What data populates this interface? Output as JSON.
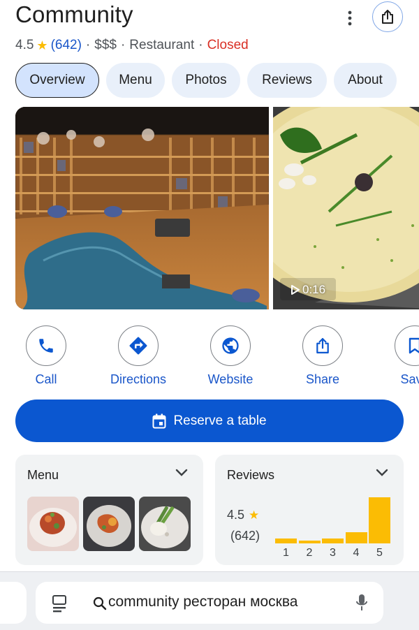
{
  "place": {
    "name": "Community",
    "rating": "4.5",
    "review_count": "(642)",
    "price": "$$$",
    "category": "Restaurant",
    "status": "Closed"
  },
  "tabs": [
    {
      "label": "Overview",
      "active": true
    },
    {
      "label": "Menu",
      "active": false
    },
    {
      "label": "Photos",
      "active": false
    },
    {
      "label": "Reviews",
      "active": false
    },
    {
      "label": "About",
      "active": false
    }
  ],
  "photos": {
    "video_duration": "0:16"
  },
  "actions": [
    {
      "label": "Call",
      "icon": "phone-icon"
    },
    {
      "label": "Directions",
      "icon": "directions-icon"
    },
    {
      "label": "Website",
      "icon": "globe-icon"
    },
    {
      "label": "Share",
      "icon": "share-icon"
    },
    {
      "label": "Save",
      "icon": "bookmark-icon"
    }
  ],
  "reserve_label": "Reserve a table",
  "menu_card": {
    "title": "Menu"
  },
  "reviews_card": {
    "title": "Reviews",
    "rating": "4.5",
    "count": "(642)",
    "distribution": [
      {
        "stars": "1",
        "share": 0.1
      },
      {
        "stars": "2",
        "share": 0.05
      },
      {
        "stars": "3",
        "share": 0.1
      },
      {
        "stars": "4",
        "share": 0.24
      },
      {
        "stars": "5",
        "share": 1.0
      }
    ]
  },
  "search": {
    "query": "community ресторан москва"
  },
  "colors": {
    "accent": "#1a56c9",
    "primary_button": "#0b57d0",
    "closed": "#d93025",
    "star": "#fbbc04"
  }
}
